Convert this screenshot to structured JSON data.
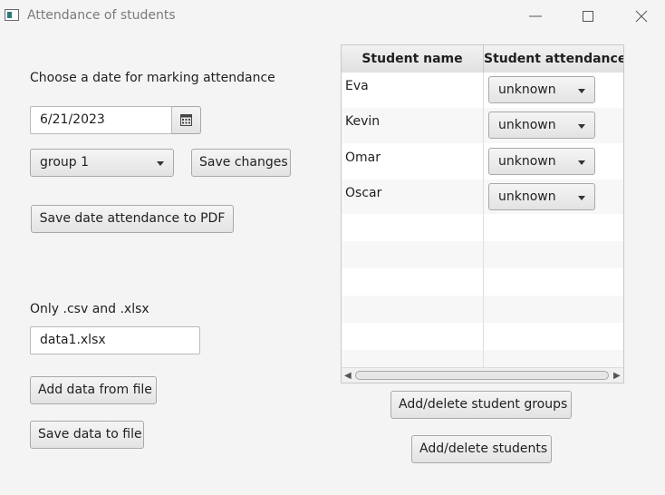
{
  "window": {
    "title": "Attendance of students"
  },
  "left": {
    "date_prompt": "Choose a date for marking attendance",
    "date_value": "6/21/2023",
    "group_selected": "group 1",
    "save_changes": "Save changes",
    "save_pdf": "Save date attendance to PDF",
    "file_hint": "Only .csv and .xlsx",
    "file_value": "data1.xlsx",
    "add_data": "Add data from file",
    "save_data": "Save data to file"
  },
  "table": {
    "headers": [
      "Student name",
      "Student attendance"
    ],
    "rows": [
      {
        "name": "Eva",
        "attendance": "unknown"
      },
      {
        "name": "Kevin",
        "attendance": "unknown"
      },
      {
        "name": "Omar",
        "attendance": "unknown"
      },
      {
        "name": "Oscar",
        "attendance": "unknown"
      }
    ]
  },
  "right": {
    "groups_button": "Add/delete student groups",
    "students_button": "Add/delete students"
  },
  "icons": {
    "calendar": "calendar-icon",
    "dropdown": "chevron-down-icon"
  }
}
